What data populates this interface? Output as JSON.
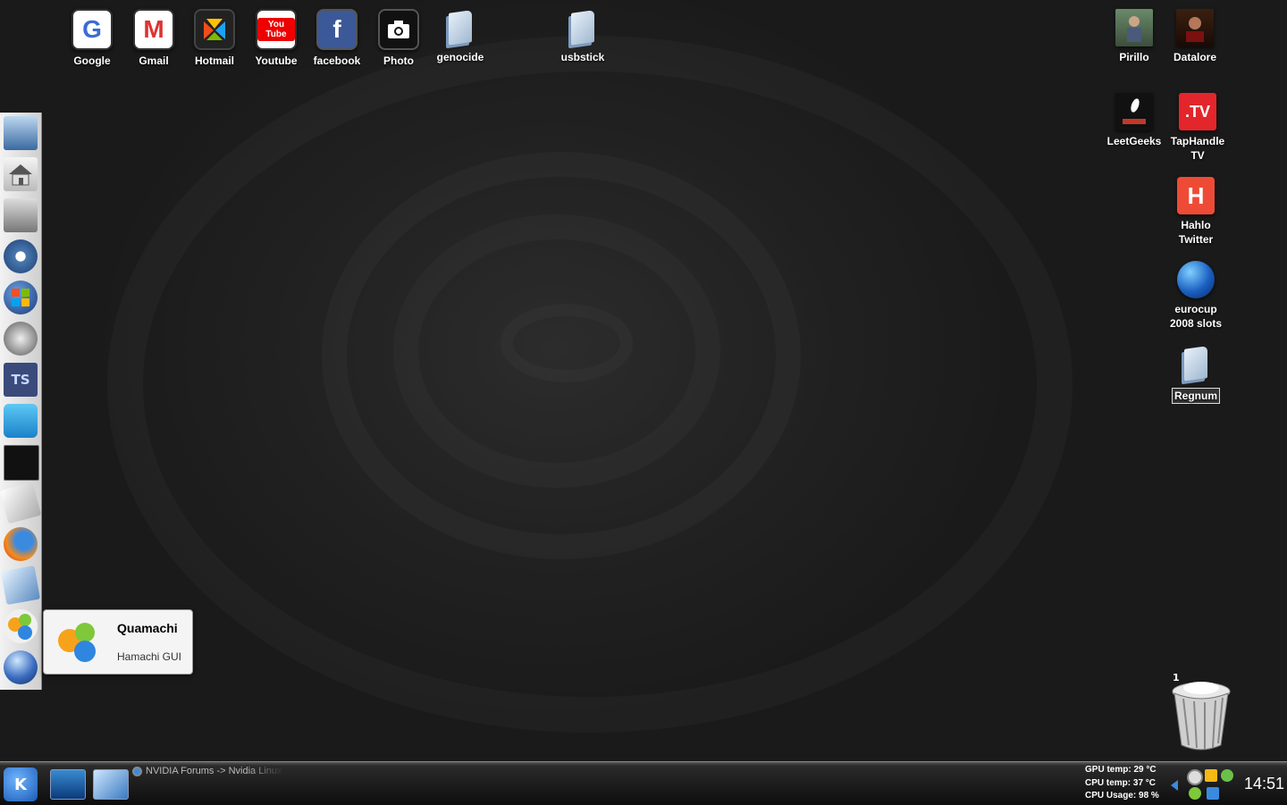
{
  "desktop": {
    "icons_top": [
      {
        "label": "Google"
      },
      {
        "label": "Gmail"
      },
      {
        "label": "Hotmail"
      },
      {
        "label": "Youtube"
      },
      {
        "label": "facebook"
      },
      {
        "label": "Photo"
      },
      {
        "label": "genocide"
      },
      {
        "label": "usbstick"
      }
    ],
    "icons_right": [
      {
        "label": "Pirillo"
      },
      {
        "label": "Datalore"
      },
      {
        "label": "LeetGeeks"
      },
      {
        "label": "TapHandle TV"
      },
      {
        "label": "Hahlo Twitter"
      },
      {
        "label": "eurocup 2008 slots"
      },
      {
        "label": "Regnum"
      }
    ],
    "trash": {
      "count": "1"
    }
  },
  "tooltip": {
    "title": "Quamachi",
    "subtitle": "Hamachi GUI"
  },
  "taskbar": {
    "task_item": "NVIDIA Forums -> Nvidia Linux",
    "sensors": {
      "gpu": "GPU temp: 29 °C",
      "cpu": "CPU temp: 37 °C",
      "usage": "CPU Usage: 98 %"
    },
    "clock": "14:51"
  },
  "icon_texts": {
    "youtube": "You Tube",
    "tv": ".TV",
    "ts": "TS",
    "hahlo": "H"
  }
}
